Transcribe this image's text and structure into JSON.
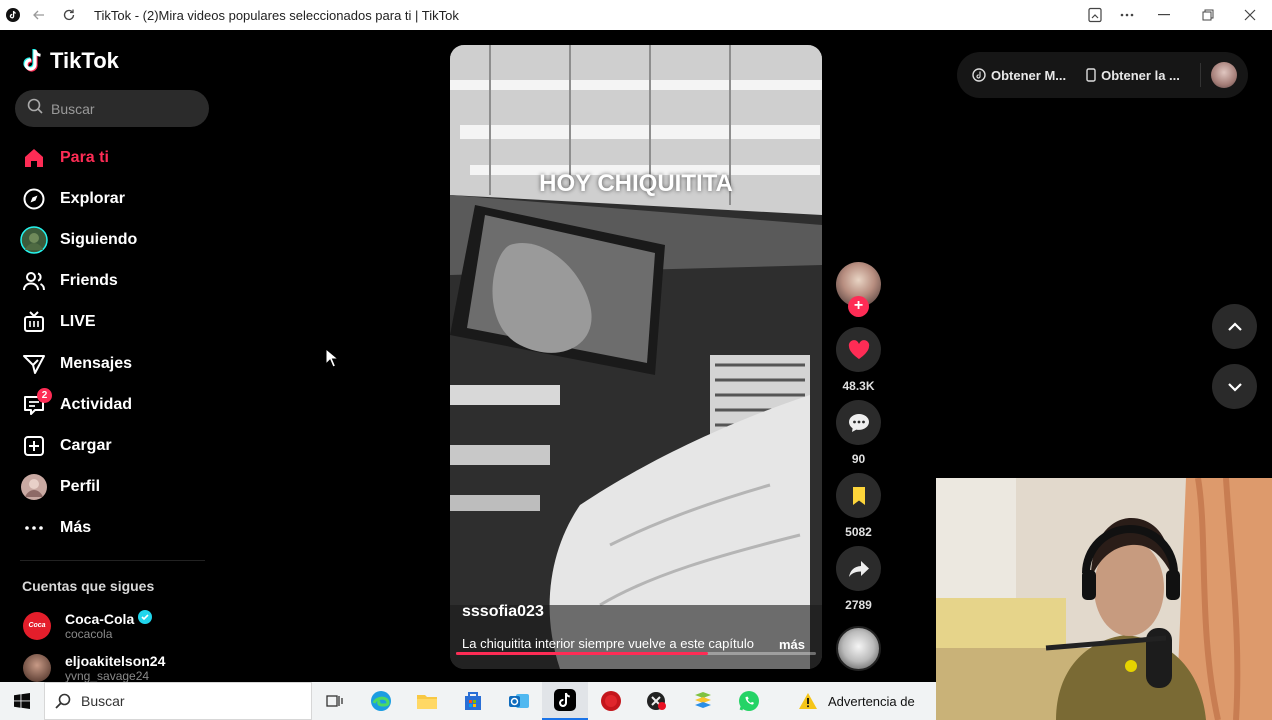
{
  "window": {
    "title": "TikTok - (2)Mira videos populares seleccionados para ti | TikTok"
  },
  "brand": {
    "name": "TikTok",
    "accent": "#fe2c55"
  },
  "search": {
    "placeholder": "Buscar"
  },
  "nav": [
    {
      "label": "Para ti",
      "icon": "home-icon",
      "active": true
    },
    {
      "label": "Explorar",
      "icon": "compass-icon"
    },
    {
      "label": "Siguiendo",
      "icon": "following-avatar-icon"
    },
    {
      "label": "Friends",
      "icon": "friends-icon"
    },
    {
      "label": "LIVE",
      "icon": "live-tv-icon"
    },
    {
      "label": "Mensajes",
      "icon": "send-icon"
    },
    {
      "label": "Actividad",
      "icon": "activity-icon",
      "badge": "2"
    },
    {
      "label": "Cargar",
      "icon": "upload-plus-icon"
    },
    {
      "label": "Perfil",
      "icon": "profile-avatar-icon"
    },
    {
      "label": "Más",
      "icon": "more-dots-icon"
    }
  ],
  "following": {
    "title": "Cuentas que sigues",
    "accounts": [
      {
        "name": "Coca-Cola",
        "handle": "cocacola",
        "verified": true
      },
      {
        "name": "eljoakitelson24",
        "handle": "yvng_savage24",
        "verified": false
      }
    ]
  },
  "video": {
    "caption": "HOY CHIQUITITA",
    "author": "sssofia023",
    "description": "La chiquitita interior siempre vuelve a este capítulo",
    "more_label": "más",
    "progress": 0.7
  },
  "actions": {
    "likes": "48.3K",
    "comments": "90",
    "saves": "5082",
    "shares": "2789"
  },
  "topbar": {
    "get_coins": "Obtener M...",
    "get_app": "Obtener la ..."
  },
  "taskbar": {
    "search_label": "Buscar",
    "warning": "Advertencia de",
    "apps": [
      "task-view-icon",
      "edge-icon",
      "file-explorer-icon",
      "store-icon",
      "outlook-icon",
      "tiktok-icon",
      "red-app-icon",
      "app-icon",
      "bluestacks-icon",
      "whatsapp-icon"
    ]
  }
}
